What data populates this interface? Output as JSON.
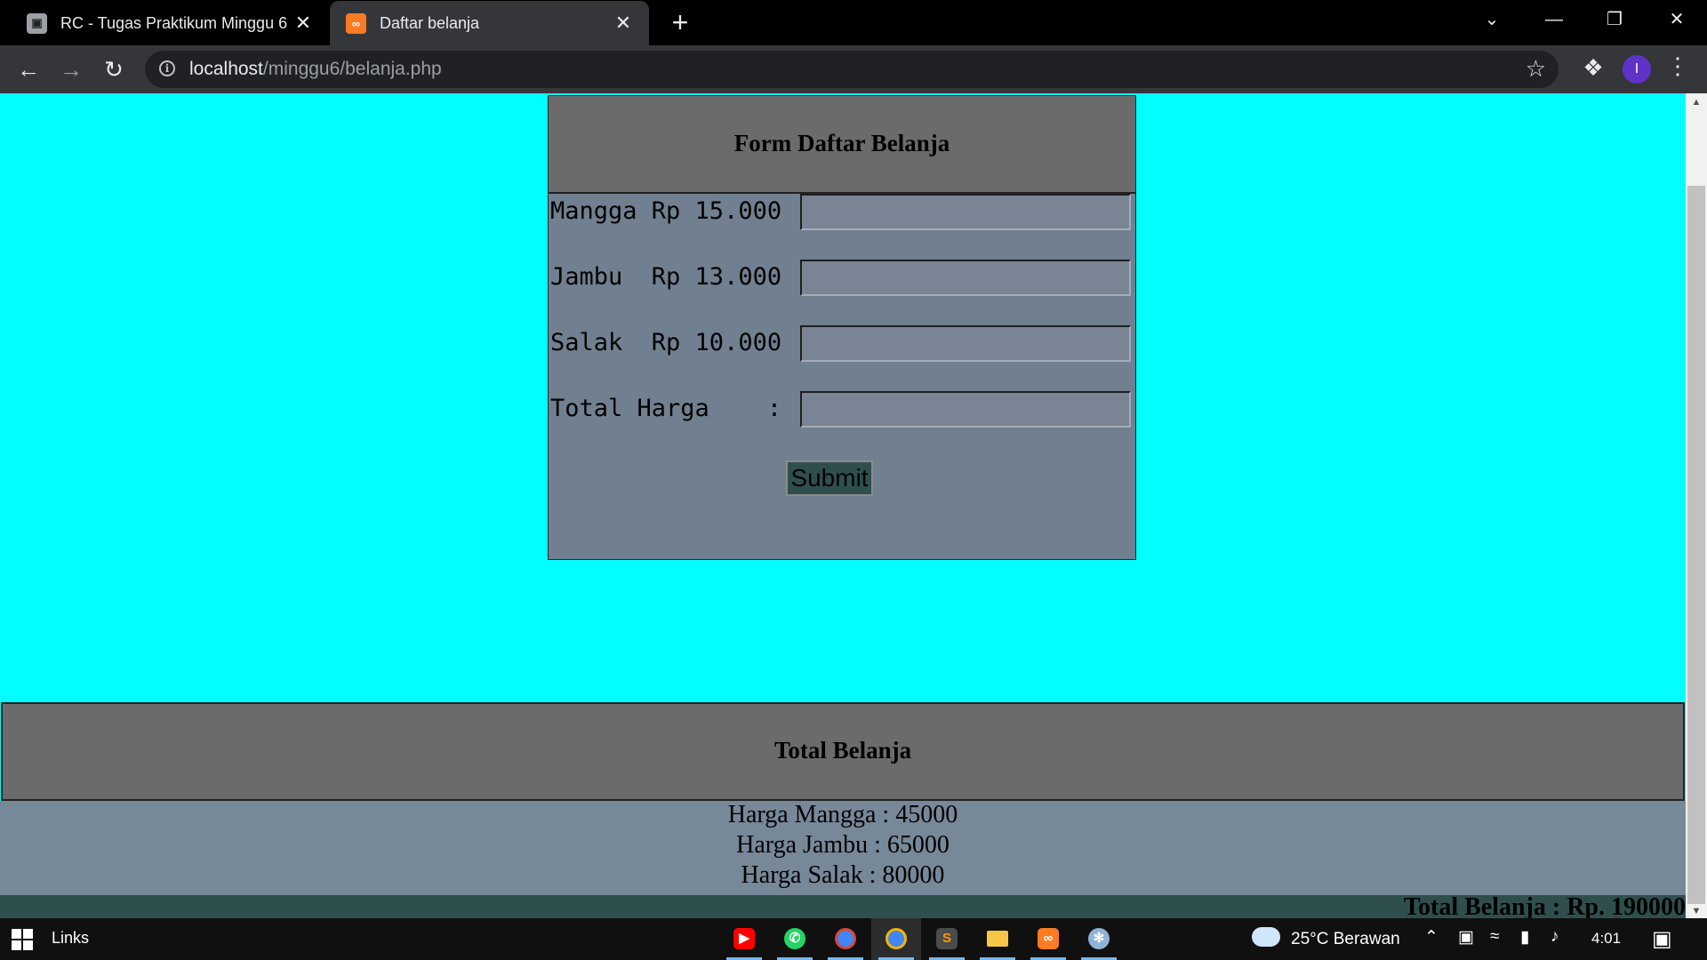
{
  "browser": {
    "tabs": [
      {
        "title": "RC - Tugas Praktikum Minggu 6",
        "favicon": "classroom-icon"
      },
      {
        "title": "Daftar belanja",
        "favicon": "xampp-icon"
      }
    ],
    "url_host": "localhost",
    "url_path": "/minggu6/belanja.php",
    "profile_initial": "I"
  },
  "form": {
    "title": "Form Daftar Belanja",
    "rows": [
      {
        "label": "Mangga Rp 15.000",
        "value": ""
      },
      {
        "label": "Jambu  Rp 13.000",
        "value": ""
      },
      {
        "label": "Salak  Rp 10.000",
        "value": ""
      },
      {
        "label": "Total Harga    :",
        "value": ""
      }
    ],
    "submit_label": "Submit"
  },
  "summary": {
    "title": "Total Belanja",
    "lines": [
      "Harga Mangga : 45000",
      "Harga Jambu : 65000",
      "Harga Salak : 80000"
    ],
    "grand_total": "Total Belanja : Rp. 190000"
  },
  "taskbar": {
    "links_label": "Links",
    "weather": "25°C  Berawan",
    "time": "4:01"
  },
  "colors": {
    "page_background": "#00ffff",
    "panel_header": "#6b6b6b",
    "form_body": "#718090",
    "results_body": "#778899",
    "button_and_footer": "#2f4f4f"
  }
}
